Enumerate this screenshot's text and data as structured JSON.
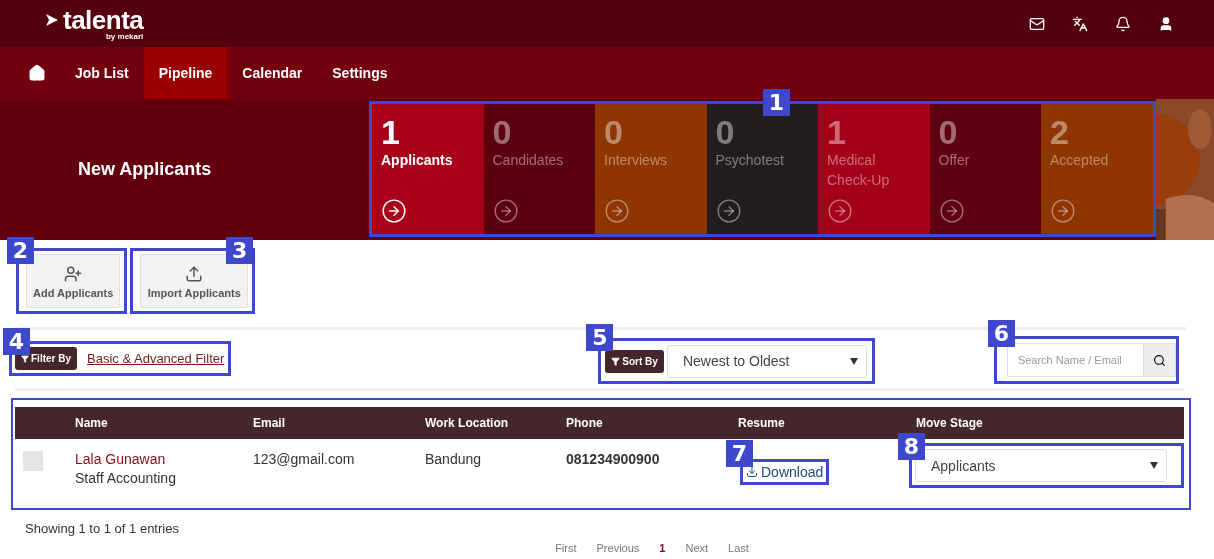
{
  "logo": {
    "name": "talenta",
    "byline": "by mekari"
  },
  "nav": [
    {
      "label": "Job List",
      "selected": false
    },
    {
      "label": "Pipeline",
      "selected": true
    },
    {
      "label": "Calendar",
      "selected": false
    },
    {
      "label": "Settings",
      "selected": false
    }
  ],
  "page_title": "New Applicants",
  "stages": [
    {
      "count": "1",
      "label": "Applicants",
      "selected": true,
      "color": "#a8001a"
    },
    {
      "count": "0",
      "label": "Candidates",
      "selected": false,
      "color": "#5c0010"
    },
    {
      "count": "0",
      "label": "Interviews",
      "selected": false,
      "color": "#8f3500"
    },
    {
      "count": "0",
      "label": "Psychotest",
      "selected": false,
      "color": "#221c21"
    },
    {
      "count": "1",
      "label": "Medical Check-Up",
      "selected": false,
      "color": "#a5001a"
    },
    {
      "count": "0",
      "label": "Offer",
      "selected": false,
      "color": "#5e0010"
    },
    {
      "count": "2",
      "label": "Accepted",
      "selected": false,
      "color": "#8f3500"
    }
  ],
  "callouts": [
    "1",
    "2",
    "3",
    "4",
    "5",
    "6",
    "7",
    "8"
  ],
  "actions": [
    {
      "label": "Add Applicants",
      "kind": "add"
    },
    {
      "label": "Import Applicants",
      "kind": "import"
    }
  ],
  "filter": {
    "chip": "Filter By",
    "link": "Basic & Advanced Filter"
  },
  "sort": {
    "chip": "Sort By",
    "value": "Newest to Oldest"
  },
  "search": {
    "placeholder": "Search Name / Email"
  },
  "table": {
    "columns": [
      "Name",
      "Email",
      "Work Location",
      "Phone",
      "Resume",
      "Move Stage"
    ],
    "rows": [
      {
        "checked": false,
        "name": "Lala Gunawan",
        "position": "Staff Accounting",
        "email": "123@gmail.com",
        "location": "Bandung",
        "phone": "081234900900",
        "resume": "Download",
        "stage": "Applicants"
      }
    ]
  },
  "footer": {
    "info": "Showing 1 to 1 of 1 entries",
    "pages": [
      {
        "label": "First",
        "selected": false
      },
      {
        "label": "Previous",
        "selected": false
      },
      {
        "label": "1",
        "selected": true
      },
      {
        "label": "Next",
        "selected": false
      },
      {
        "label": "Last",
        "selected": false
      }
    ]
  }
}
